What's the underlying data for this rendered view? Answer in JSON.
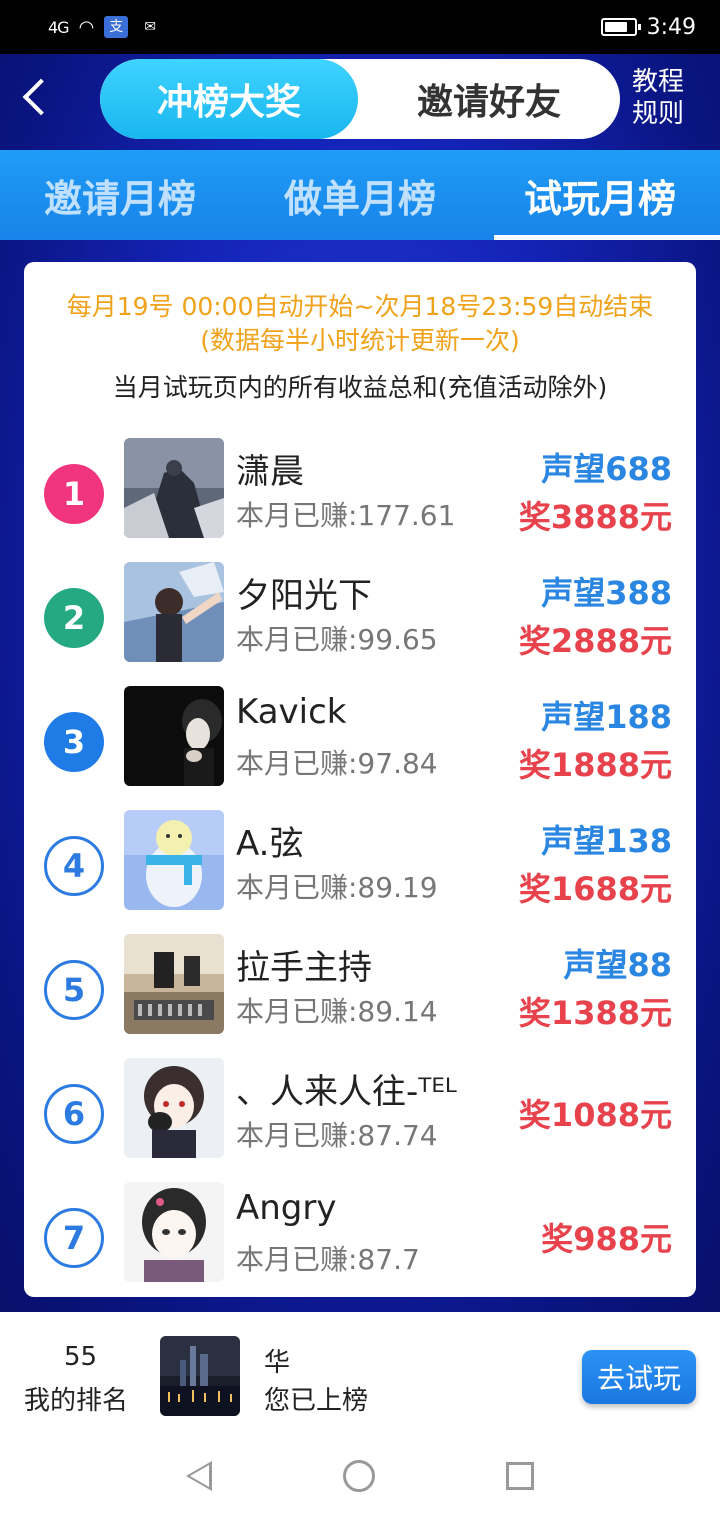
{
  "status_bar": {
    "signal": "4G",
    "time": "3:49",
    "app_icon_1": "支",
    "app_icon_2": "✉",
    "battery_level": 0.8
  },
  "header": {
    "segments": [
      {
        "label": "冲榜大奖",
        "active": true
      },
      {
        "label": "邀请好友",
        "active": false
      }
    ],
    "rules_link_line1": "教程",
    "rules_link_line2": "规则"
  },
  "tabs": [
    {
      "label": "邀请月榜",
      "active": false
    },
    {
      "label": "做单月榜",
      "active": false
    },
    {
      "label": "试玩月榜",
      "active": true
    }
  ],
  "notice": {
    "line1": "每月19号 00:00自动开始~次月18号23:59自动结束",
    "line2": "(数据每半小时统计更新一次)",
    "line3": "当月试玩页内的所有收益总和(充值活动除外)"
  },
  "ranking": [
    {
      "rank": "1",
      "name": "潇晨",
      "earned": "本月已赚:177.61",
      "prestige": "声望688",
      "prize": "奖3888元",
      "badge_color": "#f0357e",
      "badge_style": "filled"
    },
    {
      "rank": "2",
      "name": "夕阳光下",
      "earned": "本月已赚:99.65",
      "prestige": "声望388",
      "prize": "奖2888元",
      "badge_color": "#25a982",
      "badge_style": "filled"
    },
    {
      "rank": "3",
      "name": "Kavick",
      "earned": "本月已赚:97.84",
      "prestige": "声望188",
      "prize": "奖1888元",
      "badge_color": "#1f7be6",
      "badge_style": "filled"
    },
    {
      "rank": "4",
      "name": "A.弦",
      "earned": "本月已赚:89.19",
      "prestige": "声望138",
      "prize": "奖1688元",
      "badge_color": "#2d7be0",
      "badge_style": "outline"
    },
    {
      "rank": "5",
      "name": "拉手主持",
      "earned": "本月已赚:89.14",
      "prestige": "声望88",
      "prize": "奖1388元",
      "badge_color": "#2d7be0",
      "badge_style": "outline"
    },
    {
      "rank": "6",
      "name": "、人来人往-ᵀᴱᴸ",
      "earned": "本月已赚:87.74",
      "prestige": "",
      "prize": "奖1088元",
      "badge_color": "#2d7be0",
      "badge_style": "outline"
    },
    {
      "rank": "7",
      "name": "Angry",
      "earned": "本月已赚:87.7",
      "prestige": "",
      "prize": "奖988元",
      "badge_color": "#2d7be0",
      "badge_style": "outline"
    }
  ],
  "my_rank": {
    "number": "55",
    "label": "我的排名",
    "name": "华",
    "status": "您已上榜",
    "button_label": "去试玩"
  },
  "nav_bar": {
    "back_icon": "triangle-back-icon",
    "home_icon": "circle-home-icon",
    "recent_icon": "square-recent-icon"
  },
  "colors": {
    "accent_blue": "#2a86e0",
    "prize_red": "#e8434d",
    "notice_orange": "#f0a21a"
  }
}
